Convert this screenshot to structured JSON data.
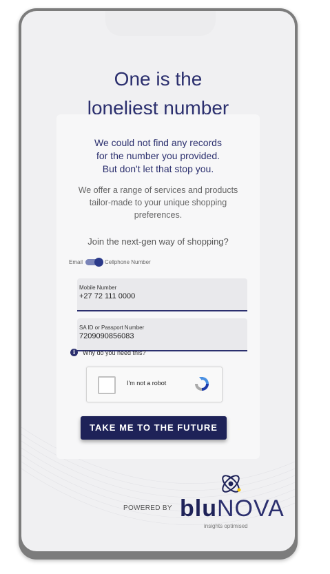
{
  "title_line1": "One is the",
  "title_line2": "loneliest number",
  "message": {
    "line1": "We could not find any records",
    "line2": "for the number you provided.",
    "line3": "But don't let that stop you."
  },
  "offer": {
    "line1": "We offer a range of services and products",
    "line2": "tailor-made to your unique shopping",
    "line3": "preferences."
  },
  "question": "Join the  next-gen way of shopping?",
  "toggle": {
    "left_label": "Email",
    "right_label": "Cellphone Number",
    "state": "on"
  },
  "mobile_field": {
    "label": "Mobile Number",
    "value": "+27 72 111 0000"
  },
  "id_field": {
    "label": "SA ID or Passport Number",
    "value": "7209090856083"
  },
  "why_link": "Why do you need this?",
  "captcha_label": "I'm not a robot",
  "submit_button": "TAKE ME TO THE FUTURE",
  "footer": {
    "powered_by": "POWERED BY",
    "brand_bold": "blu",
    "brand_thin": "NOVA",
    "tagline": "insights optimised"
  },
  "colors": {
    "primary": "#1e2258",
    "accent": "#2b2f6e",
    "background": "#f0f0f2"
  }
}
